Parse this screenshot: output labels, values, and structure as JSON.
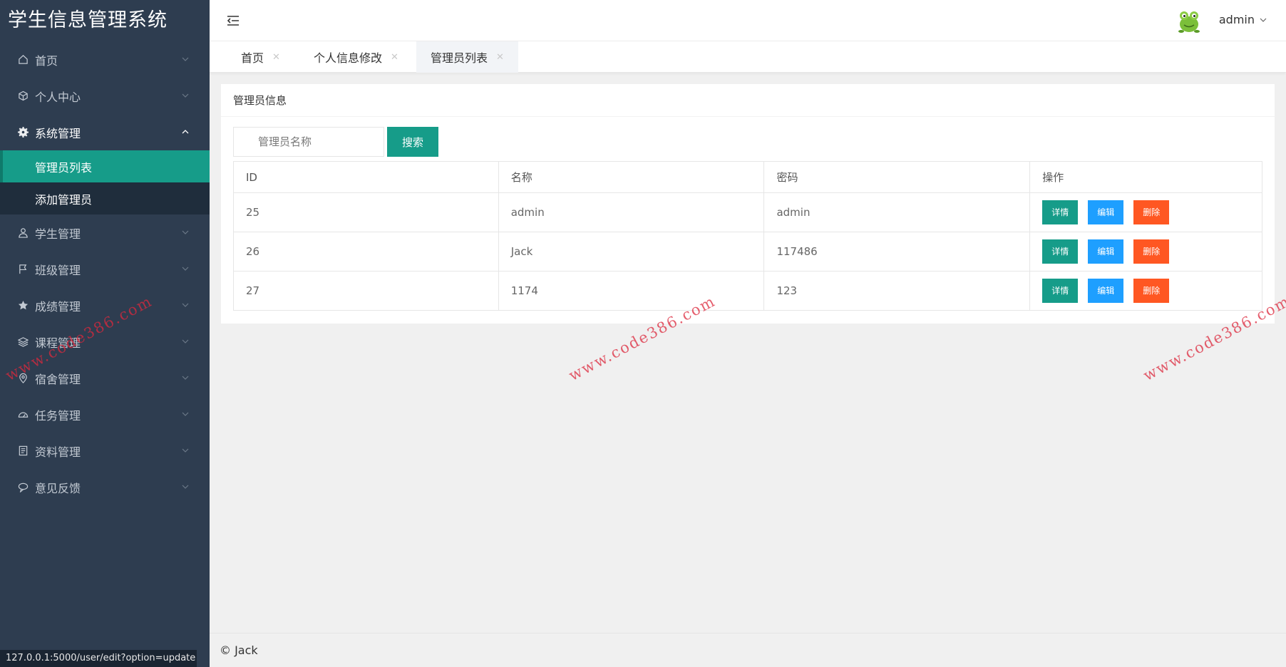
{
  "app_title": "学生信息管理系统",
  "sidebar": {
    "items": [
      {
        "label": "首页",
        "icon": "home-icon"
      },
      {
        "label": "个人中心",
        "icon": "cube-icon"
      },
      {
        "label": "系统管理",
        "icon": "gear-icon",
        "open": true,
        "children": [
          {
            "label": "管理员列表",
            "active": true
          },
          {
            "label": "添加管理员"
          }
        ]
      },
      {
        "label": "学生管理",
        "icon": "user-icon"
      },
      {
        "label": "班级管理",
        "icon": "flag-icon"
      },
      {
        "label": "成绩管理",
        "icon": "star-icon"
      },
      {
        "label": "课程管理",
        "icon": "layers-icon"
      },
      {
        "label": "宿舍管理",
        "icon": "location-icon"
      },
      {
        "label": "任务管理",
        "icon": "dashboard-icon"
      },
      {
        "label": "资料管理",
        "icon": "document-icon"
      },
      {
        "label": "意见反馈",
        "icon": "chat-icon"
      }
    ]
  },
  "header": {
    "user_name": "admin"
  },
  "tabs": [
    {
      "label": "首页"
    },
    {
      "label": "个人信息修改"
    },
    {
      "label": "管理员列表",
      "active": true
    }
  ],
  "card": {
    "title": "管理员信息",
    "search_placeholder": "管理员名称",
    "search_button": "搜索"
  },
  "table": {
    "headers": [
      "ID",
      "名称",
      "密码",
      "操作"
    ],
    "rows": [
      {
        "id": "25",
        "name": "admin",
        "password": "admin"
      },
      {
        "id": "26",
        "name": "Jack",
        "password": "117486"
      },
      {
        "id": "27",
        "name": "1174",
        "password": "123"
      }
    ],
    "actions": {
      "detail": "详情",
      "edit": "编辑",
      "delete": "删除"
    }
  },
  "footer": {
    "text": "© Jack"
  },
  "status_url": "127.0.0.1:5000/user/edit?option=update",
  "watermark": "www.code386.com",
  "colors": {
    "sidebar_bg": "#2e3d50",
    "accent": "#169c89",
    "edit_button": "#1e9fff",
    "delete_button": "#ff5722"
  }
}
